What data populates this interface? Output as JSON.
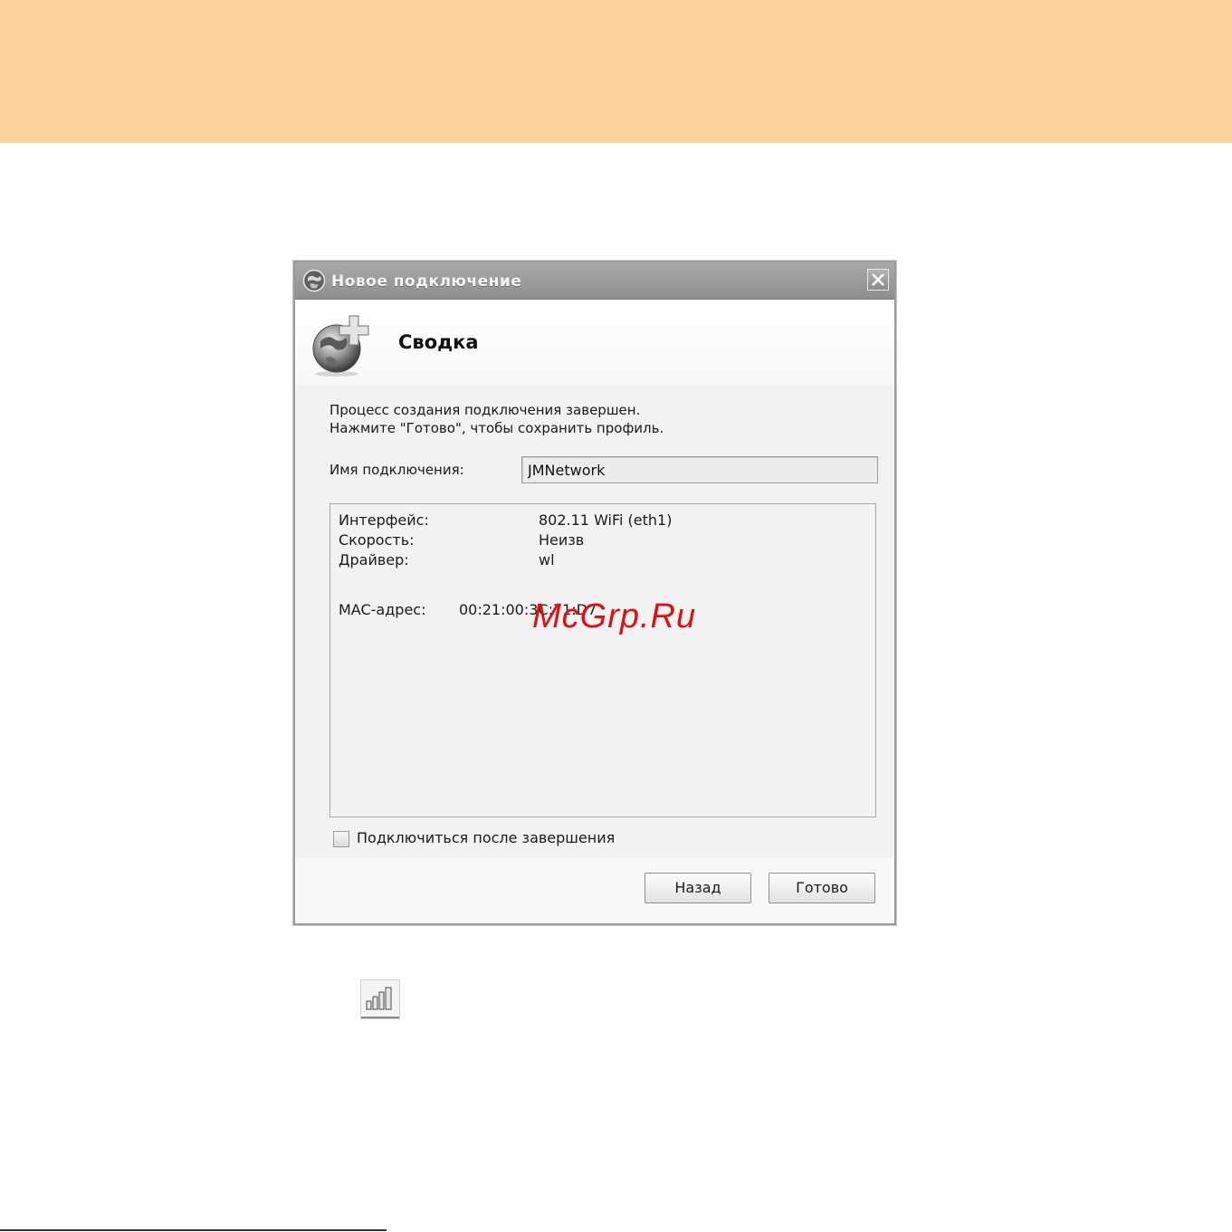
{
  "dialog": {
    "title": "Новое подключение",
    "header_title": "Сводка",
    "description_line1": "Процесс создания подключения завершен.",
    "description_line2": "Нажмите \"Готово\", чтобы сохранить профиль.",
    "connection_name_label": "Имя подключения:",
    "connection_name_value": "JMNetwork",
    "info": {
      "interface_label": "Интерфейс:",
      "interface_value": "802.11 WiFi (eth1)",
      "speed_label": "Скорость:",
      "speed_value": "Неизв",
      "driver_label": "Драйвер:",
      "driver_value": "wl",
      "mac_label": "MAC-адрес:",
      "mac_value": "00:21:00:3C:71:D7"
    },
    "connect_after_label": "Подключиться после завершения",
    "connect_after_checked": false,
    "back_button": "Назад",
    "done_button": "Готово"
  },
  "watermark": "McGrp.Ru",
  "icons": {
    "title_icon": "globe-icon",
    "header_icon": "globe-add-icon",
    "close_icon": "close-icon",
    "signal_icon": "signal-strength-icon"
  },
  "colors": {
    "banner": "#fdd39d",
    "titlebar": "#9a9a9a",
    "watermark": "#e01010"
  }
}
